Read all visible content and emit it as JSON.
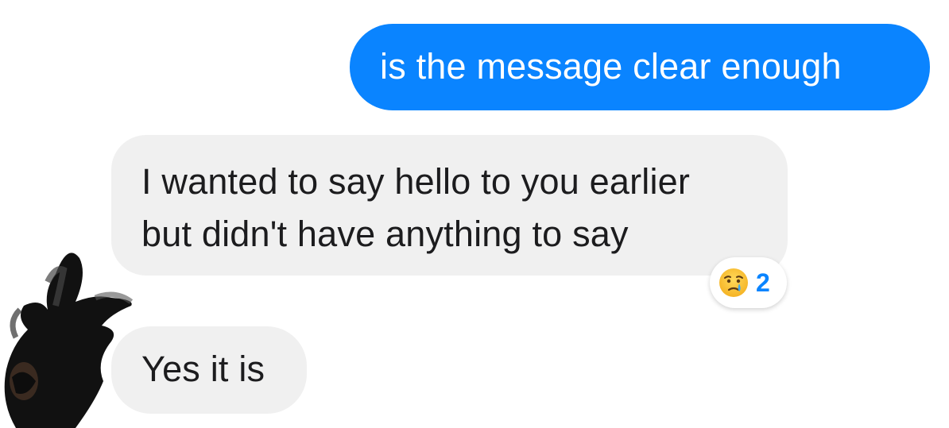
{
  "messages": {
    "outgoing_1": {
      "text": "is the message clear enough"
    },
    "incoming_1": {
      "lines": [
        "I wanted to say hello to you earlier",
        "but didn't have anything to say"
      ],
      "reaction": {
        "icon": "crying-face-icon",
        "count": "2"
      }
    },
    "incoming_2": {
      "text": "Yes it is"
    }
  },
  "colors": {
    "outgoing_bubble": "#0a84ff",
    "incoming_bubble": "#f0f0f0",
    "reaction_count": "#0a84ff"
  },
  "avatar": {
    "icon": "redacted-avatar"
  }
}
